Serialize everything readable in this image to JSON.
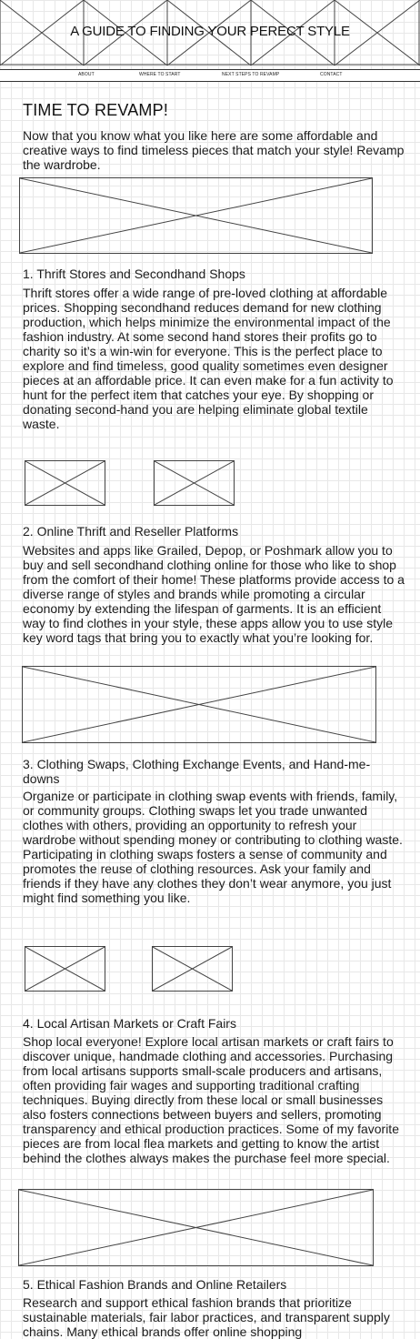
{
  "site": {
    "title": "A GUIDE TO FINDING YOUR  PERECT STYLE"
  },
  "nav": {
    "items": [
      "ABOUT",
      "WHERE TO START",
      "NEXT STEPS TO REVAMP",
      "CONTACT"
    ]
  },
  "page": {
    "heading": "TIME TO REVAMP!",
    "intro": "Now that you know what you like here are some affordable and creative ways to find timeless pieces that match your style! Revamp the wardrobe."
  },
  "sections": [
    {
      "title": "1. Thrift Stores and Secondhand Shops",
      "body": "Thrift stores offer a wide range of pre-loved clothing at affordable prices. Shopping secondhand reduces demand for new clothing production, which helps minimize the environmental impact of the fashion industry. At some second hand stores their profits go to charity so it’s a win-win for everyone. This is the perfect place to explore and find timeless, good quality sometimes even designer pieces at an affordable price. It can even make for a fun activity to hunt for the perfect item that catches your eye. By shopping or donating second-hand you are helping eliminate global textile waste."
    },
    {
      "title": "2. Online Thrift and Reseller Platforms",
      "body": "Websites and apps like Grailed, Depop, or Poshmark allow you to buy and sell secondhand clothing online for those who like to shop from the comfort of their home! These platforms provide access to a diverse range of styles and brands while promoting a circular economy by extending the lifespan of garments. It is an efficient way to find clothes in your style, these apps allow you to use style key word tags that bring you to exactly what you’re looking for."
    },
    {
      "title": "3. Clothing Swaps, Clothing Exchange Events, and Hand-me-downs",
      "body": "Organize or participate in clothing swap events with friends, family, or community groups. Clothing swaps let you trade unwanted clothes with others, providing an opportunity to refresh your wardrobe without spending money or contributing to clothing waste. Participating in clothing swaps fosters a sense of community and promotes the reuse of clothing resources. Ask your family and friends if they have any clothes they don’t wear anymore, you just might find something you like."
    },
    {
      "title": "4. Local Artisan Markets or Craft Fairs",
      "body": "Shop local everyone! Explore local artisan markets or craft fairs to discover unique, handmade clothing and accessories. Purchasing from local artisans supports small-scale producers and artisans, often providing fair wages and supporting traditional crafting techniques. Buying directly from these local or small businesses also fosters connections between buyers and sellers, promoting transparency and ethical production practices. Some of my favorite pieces are from local flea markets and getting to know the artist behind the clothes always makes the purchase feel more special."
    },
    {
      "title": "5. Ethical Fashion Brands and Online Retailers",
      "body": "Research and support ethical fashion brands that prioritize sustainable materials, fair labor practices, and transparent supply chains. Many ethical brands offer online shopping"
    }
  ]
}
